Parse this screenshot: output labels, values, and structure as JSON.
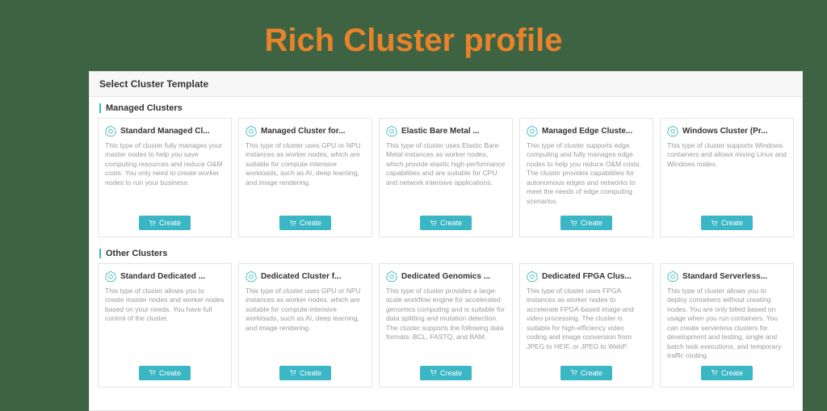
{
  "slide_title": "Rich Cluster profile",
  "panel": {
    "header": "Select Cluster Template",
    "create_label": "Create",
    "sections": [
      {
        "title": "Managed Clusters",
        "cards": [
          {
            "title": "Standard Managed Cl...",
            "desc": "This type of cluster fully manages your master nodes to help you save computing resources and reduce O&M costs. You only need to create worker nodes to run your business."
          },
          {
            "title": "Managed Cluster for...",
            "desc": "This type of cluster uses GPU or NPU instances as worker nodes, which are suitable for compute-intensive workloads, such as AI, deep learning, and image rendering."
          },
          {
            "title": "Elastic Bare Metal ...",
            "desc": "This type of cluster uses Elastic Bare Metal instances as worker nodes, which provide elastic high-performance capabilities and are suitable for CPU and network intensive applications."
          },
          {
            "title": "Managed Edge Cluste...",
            "desc": "This type of cluster supports edge computing and fully manages edge nodes to help you reduce O&M costs. The cluster provides capabilities for autonomous edges and networks to meet the needs of edge computing scenarios."
          },
          {
            "title": "Windows Cluster (Pr...",
            "desc": "This type of cluster supports Windows containers and allows mixing Linux and Windows nodes."
          }
        ]
      },
      {
        "title": "Other Clusters",
        "cards": [
          {
            "title": "Standard Dedicated ...",
            "desc": "This type of cluster allows you to create master nodes and worker nodes based on your needs. You have full control of the cluster."
          },
          {
            "title": "Dedicated Cluster f...",
            "desc": "This type of cluster uses GPU or NPU instances as worker nodes, which are suitable for compute-intensive workloads, such as AI, deep learning, and image rendering."
          },
          {
            "title": "Dedicated Genomics ...",
            "desc": "This type of cluster provides a large-scale workflow engine for accelerated genomics computing and is suitable for data splitting and mutation detection. The cluster supports the following data formats: BCL, FASTQ, and BAM."
          },
          {
            "title": "Dedicated FPGA Clus...",
            "desc": "This type of cluster uses FPGA instances as worker nodes to accelerate FPGA-based image and video processing. The cluster is suitable for high-efficiency video coding and image conversion from JPEG to HEIF, or JPEG to WebP."
          },
          {
            "title": "Standard Serverless...",
            "desc": "This type of cluster allows you to deploy containers without creating nodes. You are only billed based on usage when you run containers. You can create serverless clusters for development and testing, single and batch task executions, and temporary traffic routing."
          }
        ]
      }
    ]
  }
}
